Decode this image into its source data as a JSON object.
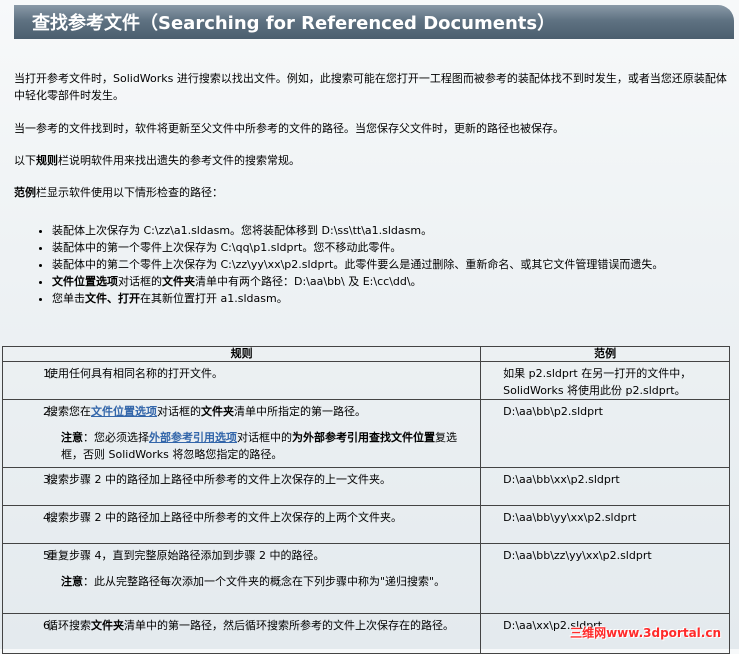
{
  "title": "查找参考文件（Searching for Referenced Documents）",
  "paragraphs": {
    "p1": "当打开参考文件时，SolidWorks 进行搜索以找出文件。例如，此搜索可能在您打开一工程图而被参考的装配体找不到时发生，或者当您还原装配体中轻化零部件时发生。",
    "p2": "当一参考的文件找到时，软件将更新至父文件中所参考的文件的路径。当您保存父文件时，更新的路径也被保存。",
    "p3_prefix": "以下",
    "p3_bold": "规则",
    "p3_suffix": "栏说明软件用来找出遗失的参考文件的搜索常规。",
    "p4_bold": "范例",
    "p4_suffix": "栏显示软件使用以下情形检查的路径："
  },
  "bullets": [
    {
      "text": "装配体上次保存为  C:\\zz\\a1.sldasm。您将装配体移到  D:\\ss\\tt\\a1.sldasm。"
    },
    {
      "text": "装配体中的第一个零件上次保存为  C:\\qq\\p1.sldprt。您不移动此零件。"
    },
    {
      "text": "装配体中的第二个零件上次保存为  C:\\zz\\yy\\xx\\p2.sldprt。此零件要么是通过删除、重新命名、或其它文件管理错误而遗失。"
    },
    {
      "bold": "文件位置选项",
      "text1": "对话框的",
      "bold2": "文件夹",
      "text2": "清单中有两个路径：D:\\aa\\bb\\ 及  E:\\cc\\dd\\。"
    },
    {
      "text1": "您单击",
      "bold": "文件、打开",
      "text2": "在其新位置打开  a1.sldasm。"
    }
  ],
  "table": {
    "headers": [
      "规则",
      "范例"
    ],
    "rows": [
      {
        "num": "1.",
        "rule": "使用任何具有相同名称的打开文件。",
        "example": "如果  p2.sldprt 在另一打开的文件中，SolidWorks 将使用此份  p2.sldprt。"
      },
      {
        "num": "2.",
        "rule_a": "搜索您在",
        "rule_link": "文件位置选项",
        "rule_b": "对话框的",
        "rule_bold": "文件夹",
        "rule_c": "清单中所指定的第一路径。",
        "note_label": "注意",
        "note_a": "：您必须选择",
        "note_link": "外部参考引用选项",
        "note_b": "对话框中的",
        "note_bold": "为外部参考引用查找文件位置",
        "note_c": "复选框，否则  SolidWorks 将忽略您指定的路径。",
        "example": "D:\\aa\\bb\\p2.sldprt"
      },
      {
        "num": "3.",
        "rule": "搜索步骤  2 中的路径加上路径中所参考的文件上次保存的上一文件夹。",
        "example": "D:\\aa\\bb\\xx\\p2.sldprt"
      },
      {
        "num": "4.",
        "rule": "搜索步骤  2 中的路径加上路径中所参考的文件上次保存的上两个文件夹。",
        "example": "D:\\aa\\bb\\yy\\xx\\p2.sldprt"
      },
      {
        "num": "5.",
        "rule": "重复步骤  4，直到完整原始路径添加到步骤  2 中的路径。",
        "note_label": "注意",
        "note_text": "：此从完整路径每次添加一个文件夹的概念在下列步骤中称为\"递归搜索\"。",
        "example": "D:\\aa\\bb\\zz\\yy\\xx\\p2.sldprt"
      },
      {
        "num": "6.",
        "rule_a": "循环搜索",
        "rule_bold": "文件夹",
        "rule_c": "清单中的第一路径，然后循环搜索所参考的文件上次保存在的路径。",
        "example": "D:\\aa\\xx\\p2.sldprt"
      }
    ]
  },
  "watermark": "三维网www.3dportal.cn"
}
